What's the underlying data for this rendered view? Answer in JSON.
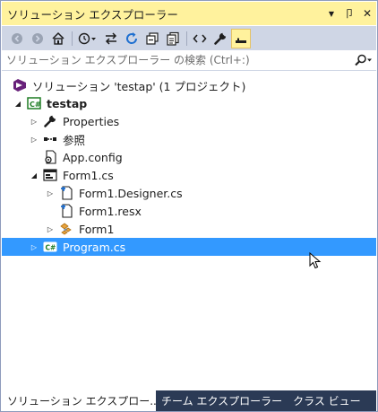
{
  "window": {
    "title": "ソリューション エクスプローラー",
    "menu_glyph": "▼",
    "pin_glyph": "卩",
    "close_glyph": "✕"
  },
  "toolbar": {
    "back_glyph": "◀",
    "forward_glyph": "▶",
    "home_glyph": "⌂",
    "pending_glyph": "◷▾",
    "sync_glyph": "⇆",
    "refresh_glyph": "↻",
    "collapse_glyph": "⧉",
    "show_all_glyph": "▣",
    "view_code_glyph": "<>",
    "properties_glyph": "🔧",
    "preview_glyph": "▬"
  },
  "search": {
    "placeholder": "ソリューション エクスプローラー の検索 (Ctrl+:)",
    "icon_glyph": "⚲▾"
  },
  "tree": {
    "solution": "ソリューション 'testap' (1 プロジェクト)",
    "project": "testap",
    "properties": "Properties",
    "references": "参照",
    "app_config": "App.config",
    "form1_cs": "Form1.cs",
    "form1_designer": "Form1.Designer.cs",
    "form1_resx": "Form1.resx",
    "form1_class": "Form1",
    "program_cs": "Program.cs",
    "expanded_glyph": "◢",
    "collapsed_glyph": "▷",
    "selected_item": "Program.cs"
  },
  "tabs": {
    "solution_explorer": "ソリューション エクスプロー...",
    "team_explorer": "チーム エクスプローラー",
    "class_view": "クラス ビュー"
  },
  "colors": {
    "title_bar": "#fff29d",
    "toolbar": "#cfd6e5",
    "selection": "#3399ff",
    "tab_strip": "#2b3a55"
  }
}
